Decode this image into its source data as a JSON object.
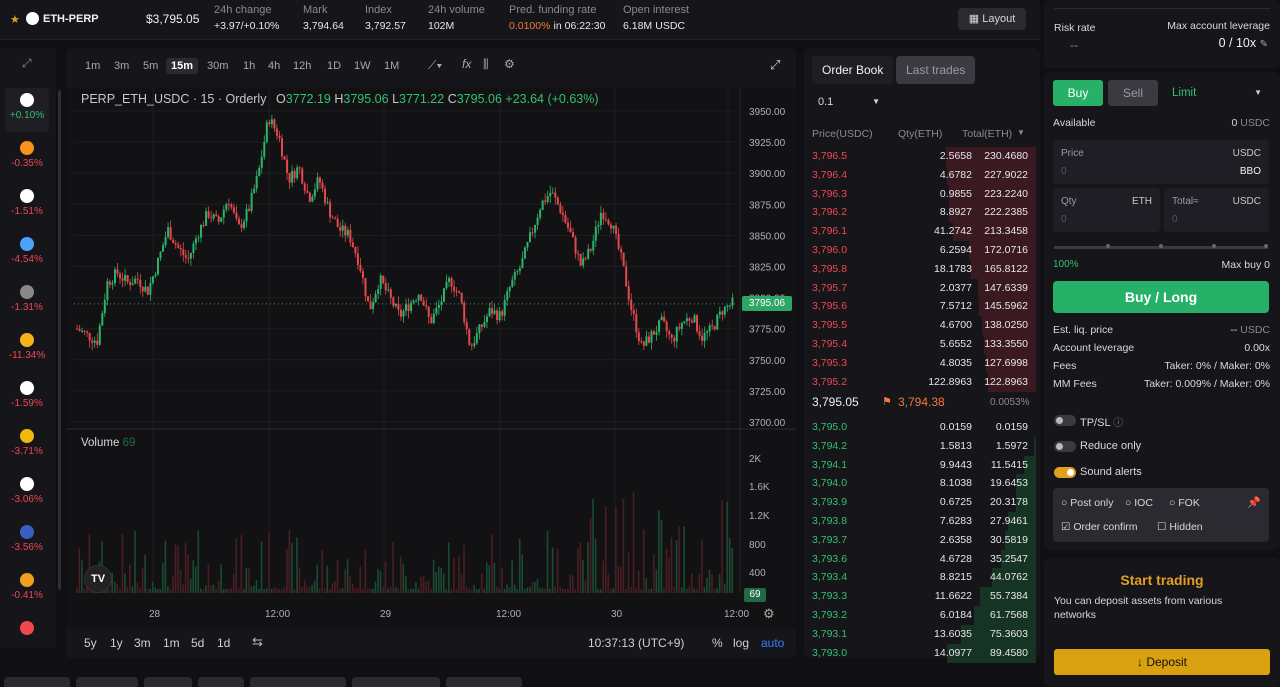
{
  "header": {
    "symbol": "ETH-PERP",
    "price": "$3,795.05",
    "stats": [
      {
        "label": "24h change",
        "value": "+3.97/+0.10%"
      },
      {
        "label": "Mark",
        "value": "3,794.64"
      },
      {
        "label": "Index",
        "value": "3,792.57"
      },
      {
        "label": "24h volume",
        "value": "102M"
      },
      {
        "label": "Pred. funding rate",
        "value": "0.0100%",
        "extra": "in 06:22:30"
      },
      {
        "label": "Open interest",
        "value": "6.18M",
        "extra": "USDC"
      }
    ],
    "layout_label": "Layout"
  },
  "rail": [
    {
      "icon": "eth-icon",
      "change": "+0.10%",
      "color": "#ffffff"
    },
    {
      "icon": "btc-icon",
      "change": "-0.35%",
      "color": "#f7931a"
    },
    {
      "icon": "ethena-icon",
      "change": "-1.51%",
      "color": "#ffffff"
    },
    {
      "icon": "sui-icon",
      "change": "-4.54%",
      "color": "#4da2ff"
    },
    {
      "icon": "x-icon",
      "change": "-1.31%",
      "color": "#888888"
    },
    {
      "icon": "doge-icon",
      "change": "-11.34%",
      "color": "#f7b21a"
    },
    {
      "icon": "coin-icon",
      "change": "-1.59%",
      "color": "#ffffff"
    },
    {
      "icon": "bnb-icon",
      "change": "-3.71%",
      "color": "#f0b90b"
    },
    {
      "icon": "c-icon",
      "change": "-3.06%",
      "color": "#ffffff"
    },
    {
      "icon": "r-icon",
      "change": "-3.56%",
      "color": "#3a5fbf"
    },
    {
      "icon": "g-icon",
      "change": "-0.41%",
      "color": "#f0a020"
    },
    {
      "icon": "app-icon",
      "change": "",
      "color": "#f0484e"
    }
  ],
  "chart": {
    "timeframes": [
      "1m",
      "3m",
      "5m",
      "15m",
      "30m",
      "1h",
      "4h",
      "12h",
      "1D",
      "1W",
      "1M"
    ],
    "active_tf": "15m",
    "legend": {
      "title": "PERP_ETH_USDC · 15 · Orderly",
      "o": "3772.19",
      "h": "3795.06",
      "l": "3771.22",
      "c": "3795.06",
      "chg": "+23.64 (+0.63%)"
    },
    "volume_label": "Volume",
    "volume_value": "69",
    "current_price": "3795.06",
    "current_vol": "69",
    "bottom_ranges": [
      "5y",
      "1y",
      "3m",
      "1m",
      "5d",
      "1d"
    ],
    "time": "10:37:13 (UTC+9)",
    "pct": "%",
    "log": "log",
    "auto": "auto"
  },
  "chart_data": {
    "type": "candlestick",
    "title": "PERP_ETH_USDC · 15 · Orderly",
    "y_ticks": [
      3950.0,
      3925.0,
      3900.0,
      3875.0,
      3850.0,
      3825.0,
      3800.0,
      3775.0,
      3750.0,
      3725.0,
      3700.0
    ],
    "ylim": [
      3700,
      3950
    ],
    "vol_ticks": [
      "2K",
      "1.6K",
      "1.2K",
      "800",
      "400"
    ],
    "x_ticks": [
      "28",
      "12:00",
      "29",
      "12:00",
      "30",
      "12:00"
    ],
    "close_path": [
      3775,
      3770,
      3765,
      3812,
      3820,
      3812,
      3815,
      3805,
      3828,
      3855,
      3840,
      3830,
      3852,
      3868,
      3860,
      3880,
      3855,
      3870,
      3900,
      3945,
      3930,
      3895,
      3905,
      3880,
      3895,
      3870,
      3855,
      3850,
      3828,
      3790,
      3815,
      3800,
      3785,
      3795,
      3805,
      3780,
      3795,
      3815,
      3800,
      3760,
      3775,
      3790,
      3785,
      3810,
      3825,
      3850,
      3875,
      3885,
      3870,
      3850,
      3825,
      3840,
      3870,
      3860,
      3830,
      3790,
      3760,
      3770,
      3780,
      3765,
      3780,
      3785,
      3768,
      3775,
      3790,
      3795
    ]
  },
  "orderbook": {
    "tabs": [
      "Order Book",
      "Last trades"
    ],
    "precision": "0.1",
    "headers": [
      "Price(USDC)",
      "Qty(ETH)",
      "Total(ETH)"
    ],
    "asks": [
      [
        "3,796.5",
        "2.5658",
        "230.4680"
      ],
      [
        "3,796.4",
        "4.6782",
        "227.9022"
      ],
      [
        "3,796.3",
        "0.9855",
        "223.2240"
      ],
      [
        "3,796.2",
        "8.8927",
        "222.2385"
      ],
      [
        "3,796.1",
        "41.2742",
        "213.3458"
      ],
      [
        "3,796.0",
        "6.2594",
        "172.0716"
      ],
      [
        "3,795.8",
        "18.1783",
        "165.8122"
      ],
      [
        "3,795.7",
        "2.0377",
        "147.6339"
      ],
      [
        "3,795.6",
        "7.5712",
        "145.5962"
      ],
      [
        "3,795.5",
        "4.6700",
        "138.0250"
      ],
      [
        "3,795.4",
        "5.6552",
        "133.3550"
      ],
      [
        "3,795.3",
        "4.8035",
        "127.6998"
      ],
      [
        "3,795.2",
        "122.8963",
        "122.8963"
      ]
    ],
    "mid": {
      "price": "3,795.05",
      "mark": "3,794.38",
      "spread": "0.0053%"
    },
    "bids": [
      [
        "3,795.0",
        "0.0159",
        "0.0159"
      ],
      [
        "3,794.2",
        "1.5813",
        "1.5972"
      ],
      [
        "3,794.1",
        "9.9443",
        "11.5415"
      ],
      [
        "3,794.0",
        "8.1038",
        "19.6453"
      ],
      [
        "3,793.9",
        "0.6725",
        "20.3178"
      ],
      [
        "3,793.8",
        "7.6283",
        "27.9461"
      ],
      [
        "3,793.7",
        "2.6358",
        "30.5819"
      ],
      [
        "3,793.6",
        "4.6728",
        "35.2547"
      ],
      [
        "3,793.4",
        "8.8215",
        "44.0762"
      ],
      [
        "3,793.3",
        "11.6622",
        "55.7384"
      ],
      [
        "3,793.2",
        "6.0184",
        "61.7568"
      ],
      [
        "3,793.1",
        "13.6035",
        "75.3603"
      ],
      [
        "3,793.0",
        "14.0977",
        "89.4580"
      ]
    ]
  },
  "account": {
    "risk_rate_label": "Risk rate",
    "risk_rate": "--",
    "max_lev_label": "Max account leverage",
    "max_lev": "0 / 10x"
  },
  "order": {
    "buy": "Buy",
    "sell": "Sell",
    "type": "Limit",
    "available_label": "Available",
    "available": "0",
    "available_unit": "USDC",
    "price_label": "Price",
    "price_unit": "USDC",
    "price_ph": "0",
    "bbo": "BBO",
    "qty_label": "Qty",
    "qty_unit": "ETH",
    "qty_ph": "0",
    "total_label": "Total≈",
    "total_unit": "USDC",
    "total_ph": "0",
    "slider_pct": "100%",
    "max_buy_label": "Max buy",
    "max_buy": "0",
    "submit": "Buy / Long",
    "info": [
      {
        "k": "Est. liq. price",
        "v": "--",
        "u": "USDC"
      },
      {
        "k": "Account leverage",
        "v": "0.00x",
        "u": ""
      },
      {
        "k": "Fees",
        "v": "Taker: 0% / Maker: 0%",
        "u": ""
      },
      {
        "k": "MM Fees",
        "v": "Taker: 0.009% / Maker: 0%",
        "u": ""
      }
    ],
    "tpsl": "TP/SL",
    "reduce": "Reduce only",
    "alerts": "Sound alerts",
    "post_only": "Post only",
    "ioc": "IOC",
    "fok": "FOK",
    "confirm": "Order confirm",
    "hidden": "Hidden"
  },
  "start": {
    "title": "Start trading",
    "desc": "You can deposit assets from various networks",
    "deposit": "Deposit"
  }
}
